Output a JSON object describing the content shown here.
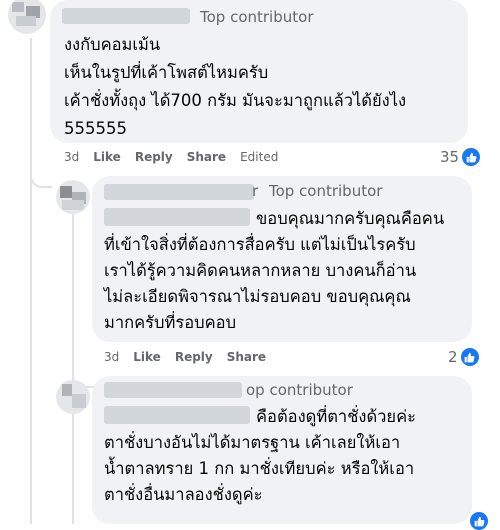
{
  "comments": [
    {
      "badge": "Top contributor",
      "lines": [
        "งงกับคอมเม้น",
        "เห็นในรูปที่เค้าโพสต์ไหมครับ",
        "เค้าชั่งทั้งถุง ได้700 กรัม มันจะมาถูกแล้วได้ยังไง",
        "555555"
      ],
      "time": "3d",
      "like": "Like",
      "reply": "Reply",
      "share": "Share",
      "edited": "Edited",
      "reaction_count": "35"
    },
    {
      "badge": "Top contributor",
      "badge_prefix": "r",
      "lines": [
        "ขอบคุณมากครับคุณคือคน",
        "ที่เข้าใจสิ่งที่ต้องการสื่อครับ แต่ไม่เป็นไรครับ",
        "เราได้รู้ความคิดคนหลากหลาย บางคนก็อ่าน",
        "ไม่ละเอียดพิจารณาไม่รอบคอบ ขอบคุณคุณ",
        "มากครับที่รอบคอบ"
      ],
      "time": "3d",
      "like": "Like",
      "reply": "Reply",
      "share": "Share",
      "reaction_count": "2"
    },
    {
      "badge": "op contributor",
      "lines": [
        "คือต้องดูที่ตาชั่งด้วยค่ะ",
        "ตาชั่งบางอันไม่ได้มาตรฐาน เค้าเลยให้เอา",
        "น้ำตาลทราย 1 กก มาชั่งเทียบค่ะ หรือให้เอา",
        "ตาชั่งอื่นมาลองชั่งดูค่ะ"
      ]
    }
  ],
  "icons": {
    "like": "thumbs-up-icon"
  },
  "colors": {
    "bubble": "#f0f2f5",
    "meta": "#65676b",
    "like_blue": "#1877f2"
  }
}
